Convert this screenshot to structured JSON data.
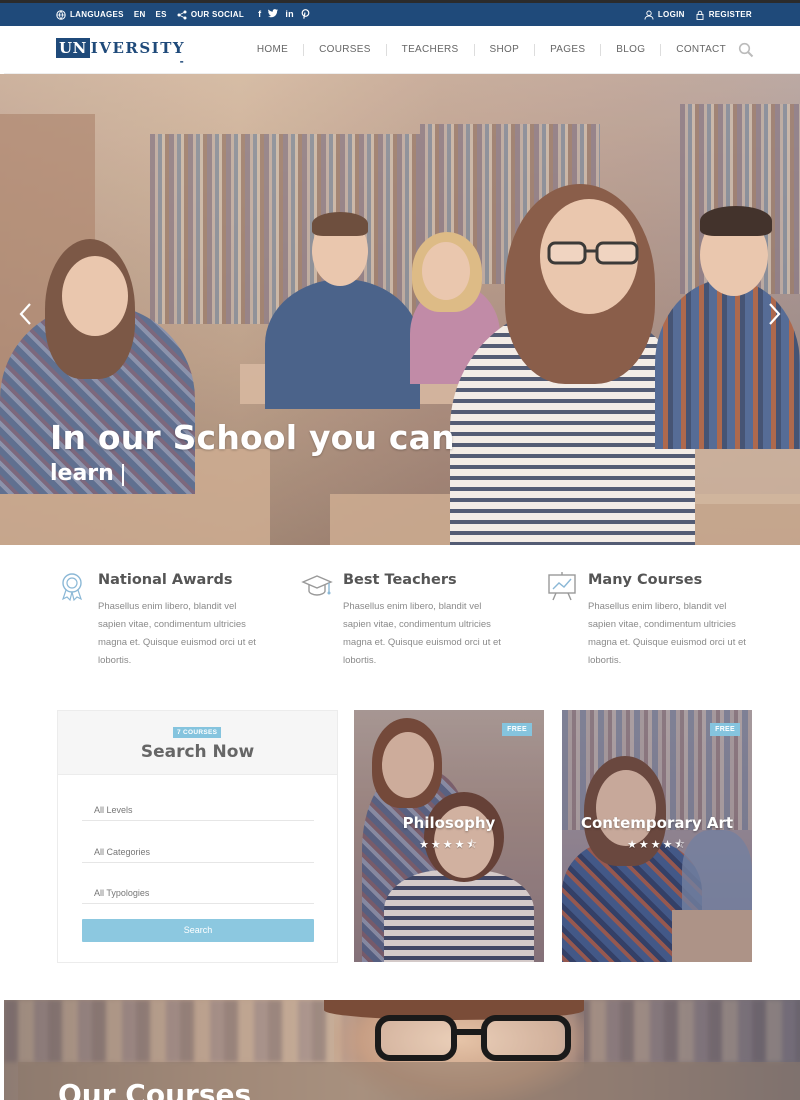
{
  "topbar": {
    "languages_label": "LANGUAGES",
    "lang_en": "EN",
    "lang_es": "ES",
    "social_label": "OUR SOCIAL",
    "social_icons": [
      "facebook-icon",
      "twitter-icon",
      "linkedin-icon",
      "pinterest-icon"
    ],
    "login_label": "LOGIN",
    "register_label": "REGISTER"
  },
  "header": {
    "logo_un": "UN",
    "logo_rest": "IVERSITY",
    "nav": [
      "HOME",
      "COURSES",
      "TEACHERS",
      "SHOP",
      "PAGES",
      "BLOG",
      "CONTACT"
    ]
  },
  "hero": {
    "title": "In our School you can",
    "subtitle": "learn"
  },
  "features": [
    {
      "title": "National Awards",
      "text": "Phasellus enim libero, blandit vel sapien vitae, condimentum ultricies magna et. Quisque euismod orci ut et lobortis.",
      "icon": "award-icon"
    },
    {
      "title": "Best Teachers",
      "text": "Phasellus enim libero, blandit vel sapien vitae, condimentum ultricies magna et. Quisque euismod orci ut et lobortis.",
      "icon": "graduation-cap-icon"
    },
    {
      "title": "Many Courses",
      "text": "Phasellus enim libero, blandit vel sapien vitae, condimentum ultricies magna et. Quisque euismod orci ut et lobortis.",
      "icon": "presentation-board-icon"
    }
  ],
  "search": {
    "badge": "7 COURSES",
    "title": "Search Now",
    "level": "All Levels",
    "category": "All Categories",
    "typology": "All Typologies",
    "button": "Search"
  },
  "cards": [
    {
      "badge": "FREE",
      "title": "Philosophy",
      "stars": "★★★★⯪",
      "rating": 4.5
    },
    {
      "badge": "FREE",
      "title": "Contemporary Art",
      "stars": "★★★★⯪",
      "rating": 4.5
    }
  ],
  "banner": {
    "title": "Our Courses"
  },
  "colors": {
    "brand": "#1f4a7a",
    "accent": "#85c4de",
    "button": "#8cc8e0"
  }
}
